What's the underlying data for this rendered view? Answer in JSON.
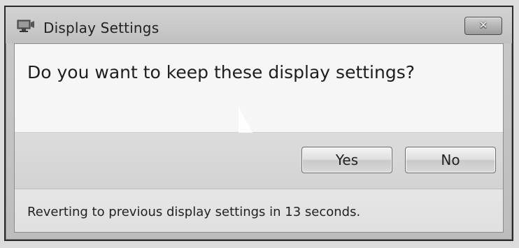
{
  "window": {
    "title": "Display Settings",
    "close_label": "✕"
  },
  "dialog": {
    "question": "Do you want to keep these display settings?",
    "yes_label": "Yes",
    "no_label": "No",
    "status": "Reverting to previous display settings in 13 seconds."
  },
  "icons": {
    "app": "display-icon",
    "close": "close-icon"
  }
}
